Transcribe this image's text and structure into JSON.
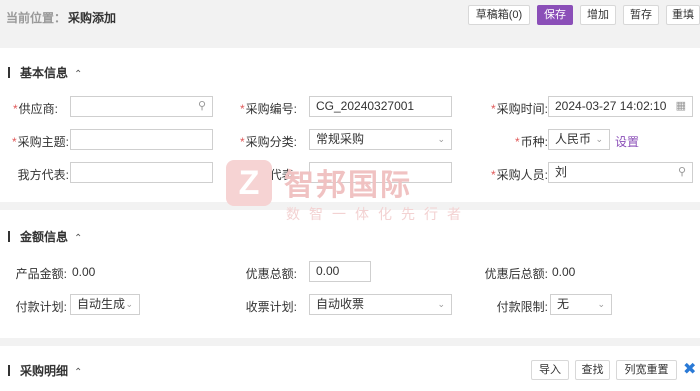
{
  "breadcrumb": {
    "prefix": "当前位置：",
    "current": "采购添加"
  },
  "toolbar": {
    "draft_box": "草稿箱(0)",
    "save": "保存",
    "add": "增加",
    "temp_save": "暂存",
    "refill": "重填"
  },
  "basic": {
    "title": "基本信息",
    "caret": "^",
    "supplier": {
      "label": "供应商:",
      "value": ""
    },
    "code": {
      "label": "采购编号:",
      "value": "CG_20240327001"
    },
    "time": {
      "label": "采购时间:",
      "value": "2024-03-27 14:02:10"
    },
    "subject": {
      "label": "采购主题:",
      "value": ""
    },
    "category": {
      "label": "采购分类:",
      "value": "常规采购"
    },
    "currency": {
      "label": "币种:",
      "value": "人民币",
      "settings_link": "设置"
    },
    "our_rep": {
      "label": "我方代表:",
      "value": ""
    },
    "their_rep": {
      "label": "对方代表:",
      "value": ""
    },
    "buyer": {
      "label": "采购人员:",
      "value": "刘"
    }
  },
  "amount": {
    "title": "金额信息",
    "caret": "^",
    "product_amount": {
      "label": "产品金额:",
      "value": "0.00"
    },
    "discount_total": {
      "label": "优惠总额:",
      "value": "0.00"
    },
    "after_discount": {
      "label": "优惠后总额:",
      "value": "0.00"
    },
    "pay_plan": {
      "label": "付款计划:",
      "value": "自动生成"
    },
    "invoice_plan": {
      "label": "收票计划:",
      "value": "自动收票"
    },
    "pay_limit": {
      "label": "付款限制:",
      "value": "无"
    }
  },
  "detail": {
    "title": "采购明细",
    "caret": "^",
    "import": "导入",
    "search": "查找",
    "reset_width": "列宽重置"
  },
  "watermark": {
    "logo_letter": "Z",
    "name": "智邦国际",
    "slogan": "数智一体化先行者"
  },
  "colors": {
    "accent": "#8b4fb8",
    "required": "#e05a5a",
    "icon_blue": "#2a7ad6"
  }
}
